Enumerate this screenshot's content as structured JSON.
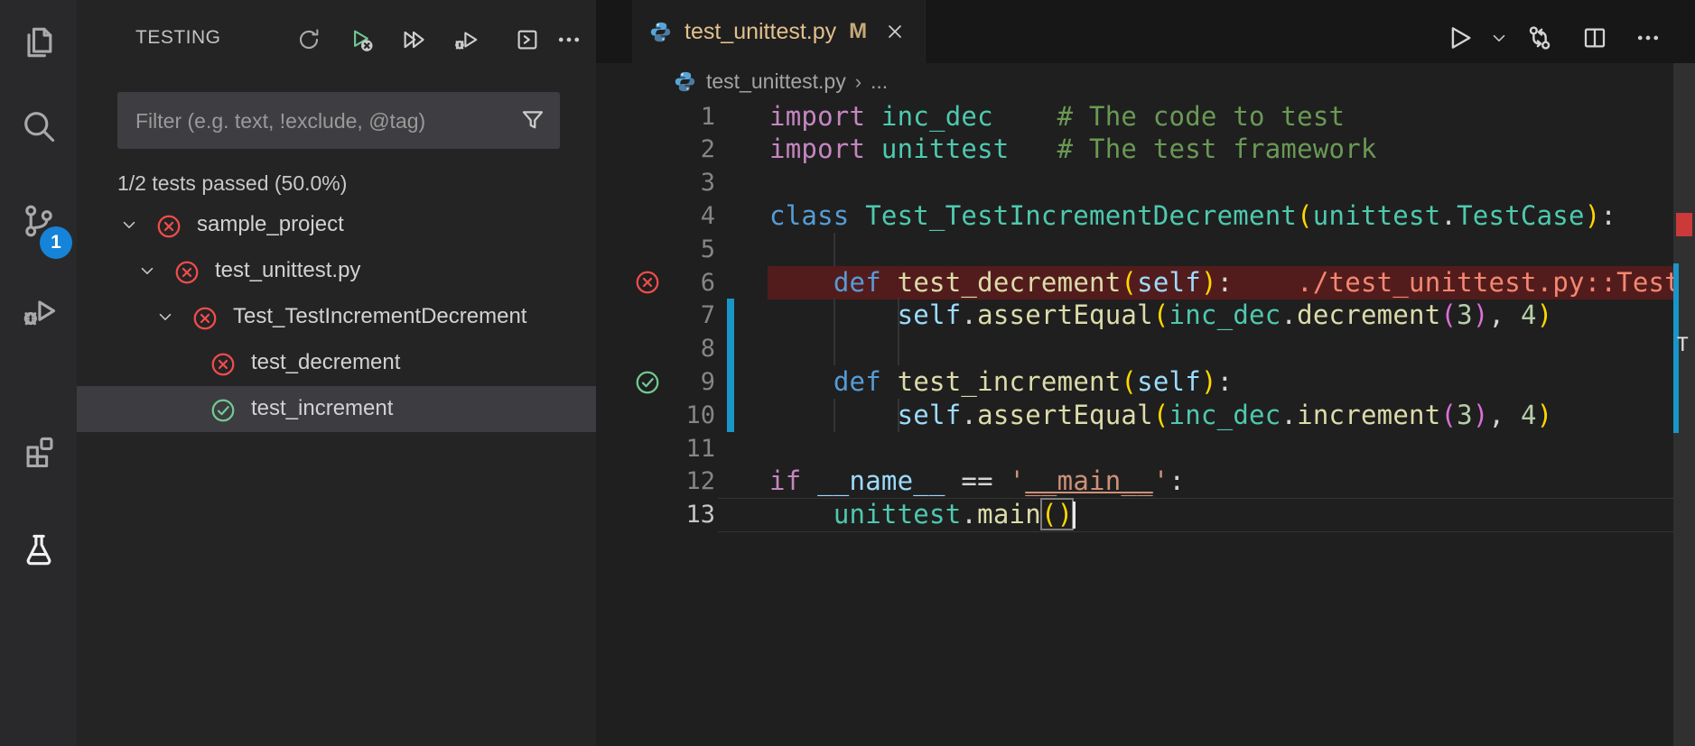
{
  "activity_bar": {
    "items": [
      {
        "name": "explorer",
        "icon": "files-icon",
        "active": false
      },
      {
        "name": "search",
        "icon": "search-icon",
        "active": false
      },
      {
        "name": "source-control",
        "icon": "source-control-icon",
        "active": false,
        "badge": "1"
      },
      {
        "name": "run-and-debug",
        "icon": "debug-icon",
        "active": false
      },
      {
        "name": "extensions",
        "icon": "extensions-icon",
        "active": false
      },
      {
        "name": "testing",
        "icon": "beaker-icon",
        "active": true
      }
    ]
  },
  "sidebar": {
    "title": "TESTING",
    "toolbar": [
      {
        "name": "refresh-tests",
        "icon": "refresh-icon"
      },
      {
        "name": "rerun-failed-tests",
        "icon": "run-failed-icon"
      },
      {
        "name": "run-all-tests",
        "icon": "run-all-icon"
      },
      {
        "name": "debug-tests",
        "icon": "debug-run-icon"
      },
      {
        "name": "show-output",
        "icon": "output-panel-icon"
      },
      {
        "name": "more-actions",
        "icon": "ellipsis-icon"
      }
    ],
    "filter": {
      "placeholder": "Filter (e.g. text, !exclude, @tag)",
      "value": "",
      "icon": "filter-funnel-icon"
    },
    "status": "1/2 tests passed (50.0%)",
    "tree": [
      {
        "label": "sample_project",
        "depth": 0,
        "status": "failed",
        "expanded": true,
        "selected": false
      },
      {
        "label": "test_unittest.py",
        "depth": 1,
        "status": "failed",
        "expanded": true,
        "selected": false
      },
      {
        "label": "Test_TestIncrementDecrement",
        "depth": 2,
        "status": "failed",
        "expanded": true,
        "selected": false
      },
      {
        "label": "test_decrement",
        "depth": 3,
        "status": "failed",
        "expanded": null,
        "selected": false
      },
      {
        "label": "test_increment",
        "depth": 3,
        "status": "passed",
        "expanded": null,
        "selected": true
      }
    ]
  },
  "editor": {
    "tab": {
      "title": "test_unittest.py",
      "modified_badge": "M",
      "icon": "python-icon",
      "close_icon": "close-icon"
    },
    "actions": [
      {
        "name": "run-python-file",
        "icon": "play-icon"
      },
      {
        "name": "run-dropdown",
        "icon": "chevron-down-icon"
      },
      {
        "name": "open-changes",
        "icon": "compare-changes-icon"
      },
      {
        "name": "split-editor",
        "icon": "split-editor-icon"
      },
      {
        "name": "more-editor-actions",
        "icon": "ellipsis-icon"
      }
    ],
    "breadcrumb": {
      "icon": "python-icon",
      "file": "test_unittest.py",
      "separator": "›",
      "rest": "..."
    },
    "overview": {
      "fragment": "T"
    },
    "colors": {
      "kw": "#C586C0",
      "def": "#569CD6",
      "type": "#4EC9B0",
      "fn": "#DCDCAA",
      "var": "#9CDCFE",
      "num": "#B5CEA8",
      "str": "#CE9178",
      "com": "#6A9955",
      "pun": "#D4D4D4",
      "b1": "#FFD700",
      "b2": "#DA70D6",
      "err": "#F48771",
      "fail": "#f14c4c",
      "pass": "#73c991",
      "modified": "#e2c08d"
    },
    "code": {
      "language": "python",
      "cursor": {
        "line": 13,
        "col": 19
      },
      "lines": [
        {
          "n": 1,
          "tokens": [
            [
              "import",
              "kw"
            ],
            [
              " ",
              "pun"
            ],
            [
              "inc_dec",
              "type"
            ],
            [
              "    ",
              "pun"
            ],
            [
              "# The code to test",
              "com"
            ]
          ]
        },
        {
          "n": 2,
          "tokens": [
            [
              "import",
              "kw"
            ],
            [
              " ",
              "pun"
            ],
            [
              "unittest",
              "type"
            ],
            [
              "   ",
              "pun"
            ],
            [
              "# The test framework",
              "com"
            ]
          ]
        },
        {
          "n": 3,
          "tokens": []
        },
        {
          "n": 4,
          "tokens": [
            [
              "class",
              "def"
            ],
            [
              " ",
              "pun"
            ],
            [
              "Test_TestIncrementDecrement",
              "type"
            ],
            [
              "(",
              "b1"
            ],
            [
              "unittest",
              "type"
            ],
            [
              ".",
              "pun"
            ],
            [
              "TestCase",
              "type"
            ],
            [
              ")",
              "b1"
            ],
            [
              ":",
              "pun"
            ]
          ]
        },
        {
          "n": 5,
          "tokens": [],
          "guides": [
            4
          ]
        },
        {
          "n": 6,
          "gutter": "failed",
          "line_bg": "error",
          "tokens": [
            [
              "    ",
              "pun"
            ],
            [
              "def",
              "def"
            ],
            [
              " ",
              "pun"
            ],
            [
              "test_decrement",
              "fn"
            ],
            [
              "(",
              "b1"
            ],
            [
              "self",
              "var"
            ],
            [
              ")",
              "b1"
            ],
            [
              ":",
              "pun"
            ],
            [
              "    ",
              "pun"
            ],
            [
              "./test_unittest.py::Test_TestIncrementDecrement",
              "err"
            ]
          ]
        },
        {
          "n": 7,
          "guides": [
            4,
            8
          ],
          "tokens": [
            [
              "        ",
              "pun"
            ],
            [
              "self",
              "var"
            ],
            [
              ".",
              "pun"
            ],
            [
              "assertEqual",
              "fn"
            ],
            [
              "(",
              "b1"
            ],
            [
              "inc_dec",
              "type"
            ],
            [
              ".",
              "pun"
            ],
            [
              "decrement",
              "fn"
            ],
            [
              "(",
              "b2"
            ],
            [
              "3",
              "num"
            ],
            [
              ")",
              "b2"
            ],
            [
              ",",
              "pun"
            ],
            [
              " ",
              "pun"
            ],
            [
              "4",
              "num"
            ],
            [
              ")",
              "b1"
            ]
          ]
        },
        {
          "n": 8,
          "tokens": [],
          "guides": [
            4,
            8
          ]
        },
        {
          "n": 9,
          "gutter": "passed",
          "tokens": [
            [
              "    ",
              "pun"
            ],
            [
              "def",
              "def"
            ],
            [
              " ",
              "pun"
            ],
            [
              "test_increment",
              "fn"
            ],
            [
              "(",
              "b1"
            ],
            [
              "self",
              "var"
            ],
            [
              ")",
              "b1"
            ],
            [
              ":",
              "pun"
            ]
          ]
        },
        {
          "n": 10,
          "guides": [
            4,
            8
          ],
          "tokens": [
            [
              "        ",
              "pun"
            ],
            [
              "self",
              "var"
            ],
            [
              ".",
              "pun"
            ],
            [
              "assertEqual",
              "fn"
            ],
            [
              "(",
              "b1"
            ],
            [
              "inc_dec",
              "type"
            ],
            [
              ".",
              "pun"
            ],
            [
              "increment",
              "fn"
            ],
            [
              "(",
              "b2"
            ],
            [
              "3",
              "num"
            ],
            [
              ")",
              "b2"
            ],
            [
              ",",
              "pun"
            ],
            [
              " ",
              "pun"
            ],
            [
              "4",
              "num"
            ],
            [
              ")",
              "b1"
            ]
          ]
        },
        {
          "n": 11,
          "tokens": []
        },
        {
          "n": 12,
          "tokens": [
            [
              "if",
              "kw"
            ],
            [
              " ",
              "pun"
            ],
            [
              "__name__",
              "var"
            ],
            [
              " ",
              "pun"
            ],
            [
              "==",
              "pun"
            ],
            [
              " ",
              "pun"
            ],
            [
              "'",
              "str"
            ],
            [
              "__main__",
              "str",
              "u"
            ],
            [
              "'",
              "str"
            ],
            [
              ":",
              "pun"
            ]
          ]
        },
        {
          "n": 13,
          "tokens": [
            [
              "    ",
              "pun"
            ],
            [
              "unittest",
              "type"
            ],
            [
              ".",
              "pun"
            ],
            [
              "main",
              "fn"
            ],
            [
              "(",
              "b1",
              "box"
            ],
            [
              ")",
              "b1",
              "box"
            ]
          ]
        }
      ],
      "modified_gutter_lines": [
        7,
        10
      ]
    }
  }
}
